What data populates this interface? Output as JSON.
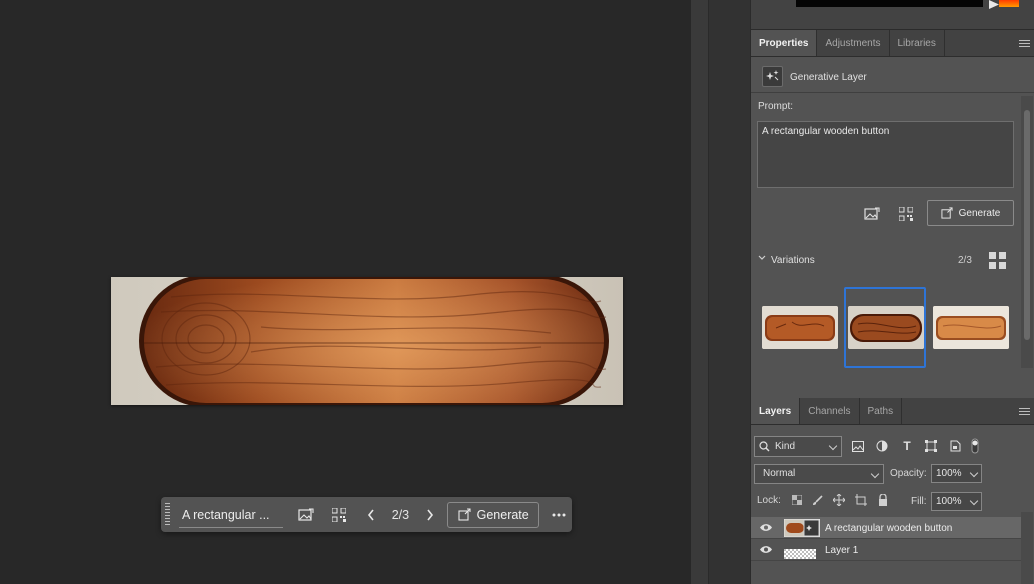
{
  "canvas": {
    "context_bar": {
      "prompt": "A rectangular ...",
      "count": "2/3",
      "generate_label": "Generate"
    }
  },
  "properties_panel": {
    "tabs": [
      "Properties",
      "Adjustments",
      "Libraries"
    ],
    "layer_type": "Generative Layer",
    "prompt_label": "Prompt:",
    "prompt_text": "A rectangular wooden button",
    "generate_label": "Generate",
    "variations_label": "Variations",
    "variations_count": "2/3",
    "selected_variation": 2,
    "accent_color": "#2e74d6"
  },
  "layers_panel": {
    "tabs": [
      "Layers",
      "Channels",
      "Paths"
    ],
    "filter_kind": "Kind",
    "blend_mode": "Normal",
    "opacity_label": "Opacity:",
    "opacity_value": "100%",
    "lock_label": "Lock:",
    "fill_label": "Fill:",
    "fill_value": "100%",
    "layers": [
      {
        "name": "A rectangular wooden button",
        "visible": true,
        "selected": true
      },
      {
        "name": "Layer 1",
        "visible": true,
        "selected": false
      }
    ]
  }
}
